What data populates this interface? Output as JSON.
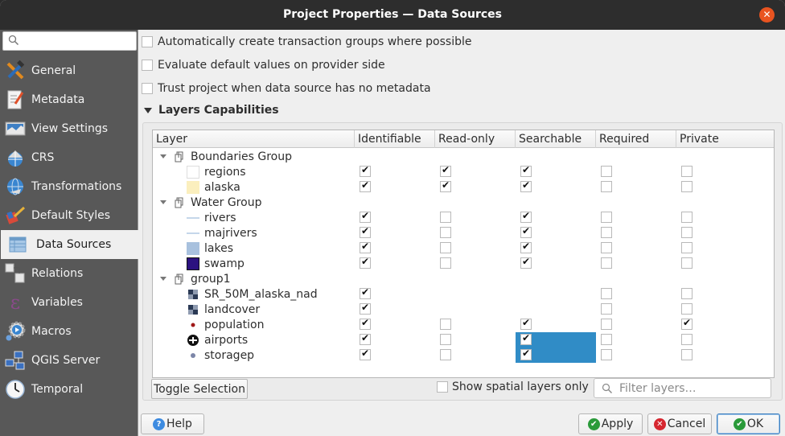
{
  "window": {
    "title": "Project Properties — Data Sources",
    "close_label": "×"
  },
  "sidebar": {
    "search_placeholder": "",
    "items": [
      {
        "label": "General",
        "icon": "hammer-wrench-icon"
      },
      {
        "label": "Metadata",
        "icon": "document-pencil-icon"
      },
      {
        "label": "View Settings",
        "icon": "map-view-icon"
      },
      {
        "label": "CRS",
        "icon": "globe-grid-icon"
      },
      {
        "label": "Transformations",
        "icon": "globe-transform-icon"
      },
      {
        "label": "Default Styles",
        "icon": "paint-brush-icon"
      },
      {
        "label": "Data Sources",
        "icon": "table-icon",
        "active": true
      },
      {
        "label": "Relations",
        "icon": "relations-icon"
      },
      {
        "label": "Variables",
        "icon": "epsilon-icon"
      },
      {
        "label": "Macros",
        "icon": "gear-play-icon"
      },
      {
        "label": "QGIS Server",
        "icon": "server-network-icon"
      },
      {
        "label": "Temporal",
        "icon": "clock-icon"
      }
    ]
  },
  "options": [
    {
      "label": "Automatically create transaction groups where possible",
      "checked": false
    },
    {
      "label": "Evaluate default values on provider side",
      "checked": false
    },
    {
      "label": "Trust project when data source has no metadata",
      "checked": false
    }
  ],
  "section": {
    "title": "Layers Capabilities",
    "expanded": true
  },
  "table": {
    "columns": [
      "Layer",
      "Identifiable",
      "Read-only",
      "Searchable",
      "Required",
      "Private"
    ],
    "rows": [
      {
        "type": "group",
        "name": "Boundaries Group"
      },
      {
        "type": "layer",
        "name": "regions",
        "symbol": "fill-white",
        "identifiable": true,
        "readonly": true,
        "searchable": true,
        "required": false,
        "private": false
      },
      {
        "type": "layer",
        "name": "alaska",
        "symbol": "fill-cream",
        "identifiable": true,
        "readonly": true,
        "searchable": true,
        "required": false,
        "private": false
      },
      {
        "type": "group",
        "name": "Water Group"
      },
      {
        "type": "layer",
        "name": "rivers",
        "symbol": "line",
        "identifiable": true,
        "readonly": false,
        "searchable": true,
        "required": false,
        "private": false
      },
      {
        "type": "layer",
        "name": "majrivers",
        "symbol": "line",
        "identifiable": true,
        "readonly": false,
        "searchable": true,
        "required": false,
        "private": false
      },
      {
        "type": "layer",
        "name": "lakes",
        "symbol": "fill-lightblue",
        "identifiable": true,
        "readonly": false,
        "searchable": true,
        "required": false,
        "private": false
      },
      {
        "type": "layer",
        "name": "swamp",
        "symbol": "fill-indigo",
        "identifiable": true,
        "readonly": false,
        "searchable": true,
        "required": false,
        "private": false
      },
      {
        "type": "group",
        "name": "group1"
      },
      {
        "type": "layer",
        "name": "SR_50M_alaska_nad",
        "symbol": "raster",
        "identifiable": true,
        "readonly": null,
        "searchable": null,
        "required": false,
        "private": false
      },
      {
        "type": "layer",
        "name": "landcover",
        "symbol": "raster",
        "identifiable": true,
        "readonly": null,
        "searchable": null,
        "required": false,
        "private": false
      },
      {
        "type": "layer",
        "name": "population",
        "symbol": "point-red",
        "identifiable": true,
        "readonly": false,
        "searchable": true,
        "required": false,
        "private": true
      },
      {
        "type": "layer",
        "name": "airports",
        "symbol": "airport",
        "identifiable": true,
        "readonly": false,
        "searchable": true,
        "required": false,
        "private": false,
        "selected": true
      },
      {
        "type": "layer",
        "name": "storagep",
        "symbol": "point-grey",
        "identifiable": true,
        "readonly": false,
        "searchable": true,
        "required": false,
        "private": false,
        "selected": true
      }
    ]
  },
  "bottom": {
    "toggle_label": "Toggle Selection",
    "spatial_only_label": "Show spatial layers only",
    "spatial_only_checked": false,
    "filter_placeholder": "Filter layers…"
  },
  "buttons": {
    "help": "Help",
    "apply": "Apply",
    "cancel": "Cancel",
    "ok": "OK"
  },
  "colors": {
    "accent": "#308cc6",
    "close": "#e95420",
    "ok_green": "#2a9a3a",
    "cancel_red": "#d6262f",
    "help_blue": "#3d8be0"
  }
}
